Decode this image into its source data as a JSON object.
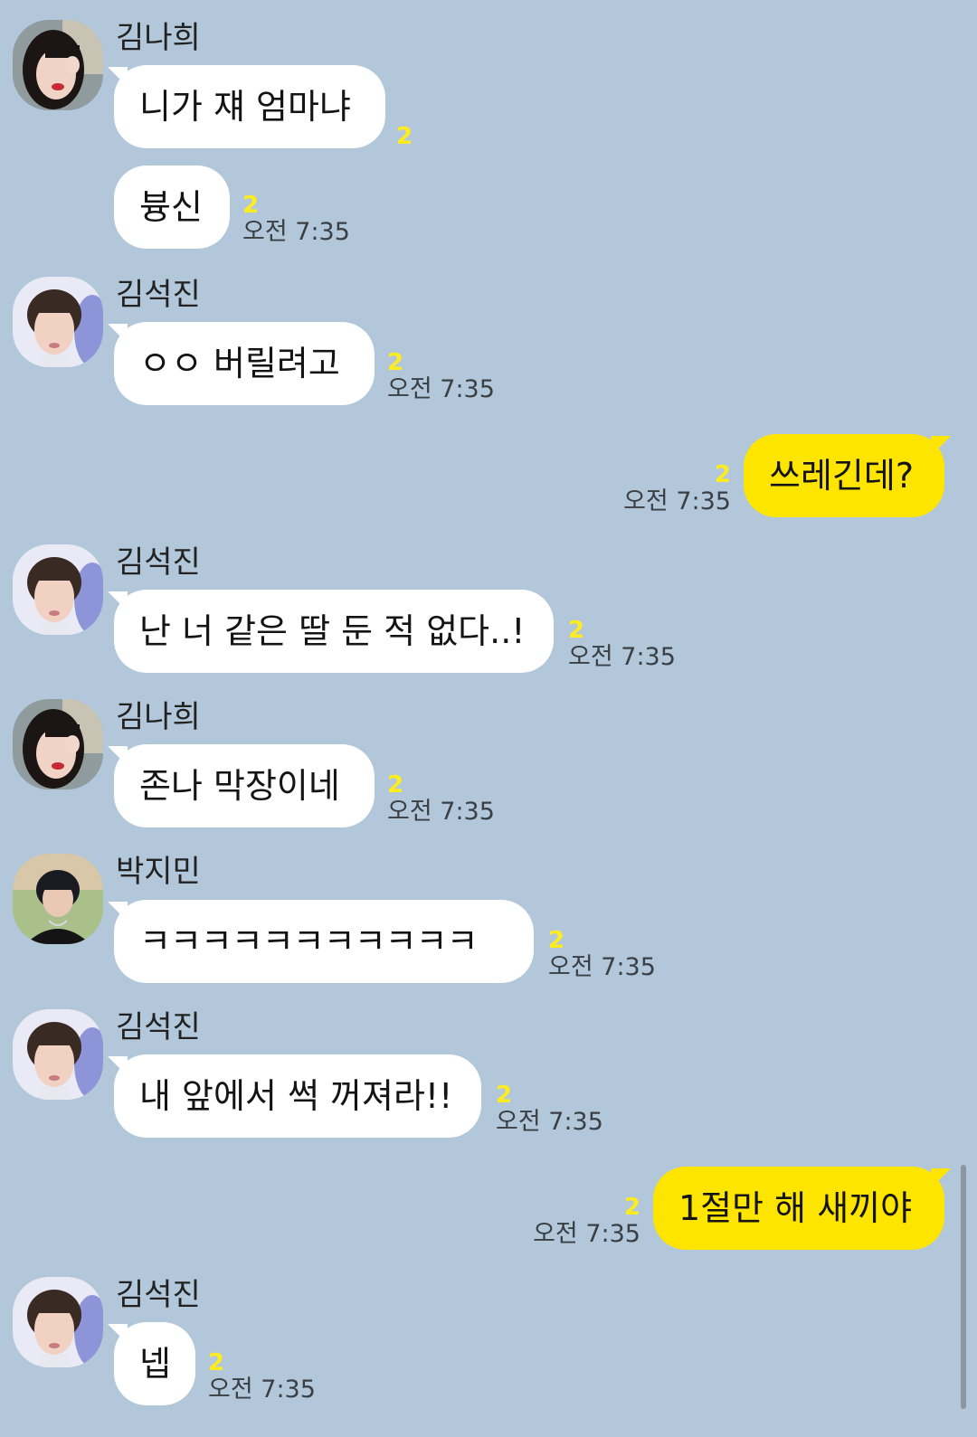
{
  "chat": {
    "messages": [
      {
        "sender": "김나희",
        "text": "니가 쟤 엄마냐",
        "unread": "2",
        "time": "",
        "avatar": "girl-avatar"
      },
      {
        "sender": "",
        "text": "븅신",
        "unread": "2",
        "time": "오전 7:35"
      },
      {
        "sender": "김석진",
        "text": "ㅇㅇ 버릴려고",
        "unread": "2",
        "time": "오전 7:35",
        "avatar": "jin-avatar"
      },
      {
        "sender": "me",
        "text": "쓰레긴데?",
        "unread": "2",
        "time": "오전 7:35"
      },
      {
        "sender": "김석진",
        "text": "난 너 같은 딸 둔 적 없다..!",
        "unread": "2",
        "time": "오전 7:35",
        "avatar": "jin-avatar"
      },
      {
        "sender": "김나희",
        "text": "존나 막장이네",
        "unread": "2",
        "time": "오전 7:35",
        "avatar": "girl-avatar"
      },
      {
        "sender": "박지민",
        "text": "ㅋㅋㅋㅋㅋㅋㅋㅋㅋㅋㅋ",
        "unread": "2",
        "time": "오전 7:35",
        "avatar": "jimin-avatar"
      },
      {
        "sender": "김석진",
        "text": "내 앞에서 썩 꺼져라!!",
        "unread": "2",
        "time": "오전 7:35",
        "avatar": "jin-avatar"
      },
      {
        "sender": "me",
        "text": "1절만 해 새끼야",
        "unread": "2",
        "time": "오전 7:35"
      },
      {
        "sender": "김석진",
        "text": "넵",
        "unread": "2",
        "time": "오전 7:35",
        "avatar": "jin-avatar"
      }
    ]
  },
  "colors": {
    "background": "#b2c7da",
    "other_bubble": "#ffffff",
    "my_bubble": "#fee500",
    "unread": "#ffec1f"
  }
}
